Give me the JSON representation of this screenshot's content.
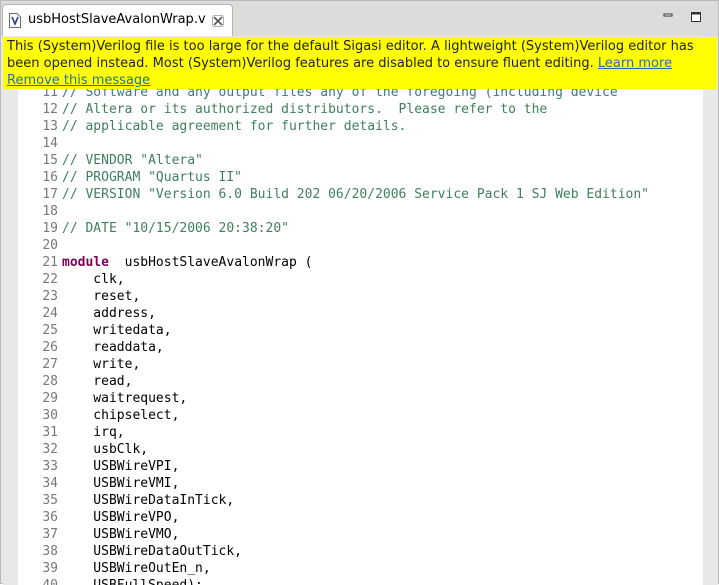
{
  "tab": {
    "title": "usbHostSlaveAvalonWrap.v",
    "file_icon": "verilog-file-icon",
    "close_icon": "close-icon"
  },
  "window_controls": {
    "minimize_icon": "minimize-icon",
    "maximize_icon": "maximize-icon"
  },
  "banner": {
    "message": "This (System)Verilog file is too large for the default Sigasi editor. A lightweight (System)Verilog editor has been opened instead. Most (System)Verilog features are disabled to ensure fluent editing. ",
    "learn_more": "Learn more",
    "remove": "Remove this message",
    "background": "#ffff00"
  },
  "editor": {
    "lines": [
      {
        "num": "11",
        "text": "// Software and any output files any of the foregoing (including device",
        "kind": "comment"
      },
      {
        "num": "12",
        "text": "// Altera or its authorized distributors.  Please refer to the",
        "kind": "comment"
      },
      {
        "num": "13",
        "text": "// applicable agreement for further details.",
        "kind": "comment"
      },
      {
        "num": "14",
        "text": "",
        "kind": "plain"
      },
      {
        "num": "15",
        "text": "// VENDOR \"Altera\"",
        "kind": "comment"
      },
      {
        "num": "16",
        "text": "// PROGRAM \"Quartus II\"",
        "kind": "comment"
      },
      {
        "num": "17",
        "text": "// VERSION \"Version 6.0 Build 202 06/20/2006 Service Pack 1 SJ Web Edition\"",
        "kind": "comment"
      },
      {
        "num": "18",
        "text": "",
        "kind": "plain"
      },
      {
        "num": "19",
        "text": "// DATE \"10/15/2006 20:38:20\"",
        "kind": "comment"
      },
      {
        "num": "20",
        "text": "",
        "kind": "plain"
      },
      {
        "num": "21",
        "keyword": "module",
        "text": "  usbHostSlaveAvalonWrap (",
        "kind": "module"
      },
      {
        "num": "22",
        "text": "    clk,",
        "kind": "plain"
      },
      {
        "num": "23",
        "text": "    reset,",
        "kind": "plain"
      },
      {
        "num": "24",
        "text": "    address,",
        "kind": "plain"
      },
      {
        "num": "25",
        "text": "    writedata,",
        "kind": "plain"
      },
      {
        "num": "26",
        "text": "    readdata,",
        "kind": "plain"
      },
      {
        "num": "27",
        "text": "    write,",
        "kind": "plain"
      },
      {
        "num": "28",
        "text": "    read,",
        "kind": "plain"
      },
      {
        "num": "29",
        "text": "    waitrequest,",
        "kind": "plain"
      },
      {
        "num": "30",
        "text": "    chipselect,",
        "kind": "plain"
      },
      {
        "num": "31",
        "text": "    irq,",
        "kind": "plain"
      },
      {
        "num": "32",
        "text": "    usbClk,",
        "kind": "plain"
      },
      {
        "num": "33",
        "text": "    USBWireVPI,",
        "kind": "plain"
      },
      {
        "num": "34",
        "text": "    USBWireVMI,",
        "kind": "plain"
      },
      {
        "num": "35",
        "text": "    USBWireDataInTick,",
        "kind": "plain"
      },
      {
        "num": "36",
        "text": "    USBWireVPO,",
        "kind": "plain"
      },
      {
        "num": "37",
        "text": "    USBWireVMO,",
        "kind": "plain"
      },
      {
        "num": "38",
        "text": "    USBWireDataOutTick,",
        "kind": "plain"
      },
      {
        "num": "39",
        "text": "    USBWireOutEn_n,",
        "kind": "plain"
      },
      {
        "num": "40",
        "text": "    USBFullSpeed);",
        "kind": "plain"
      }
    ]
  }
}
